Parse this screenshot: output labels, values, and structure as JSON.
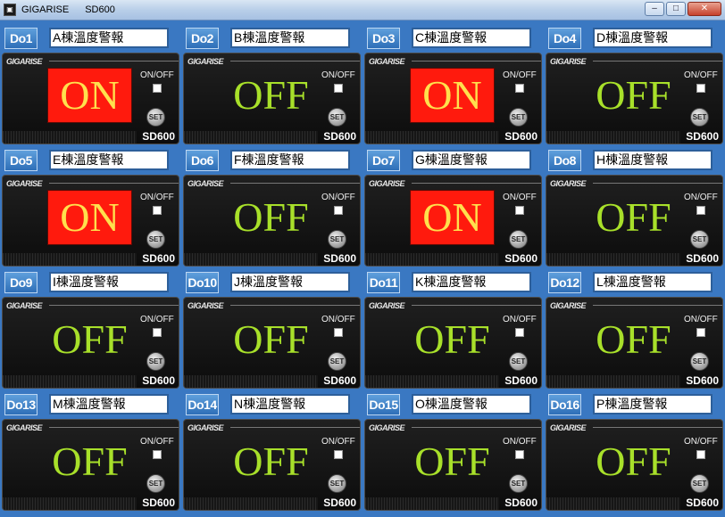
{
  "window": {
    "app_name": "GIGARISE",
    "model": "SD600",
    "icon": "app-icon",
    "buttons": {
      "minimize": "–",
      "maximize": "□",
      "close": "✕"
    }
  },
  "device_common": {
    "brand": "GIGARISE",
    "onoff_label": "ON/OFF",
    "set_label": "SET",
    "model": "SD600"
  },
  "colors": {
    "on_bg": "#ff1a0d",
    "on_text": "#ffe04d",
    "off_text": "#a8e02a",
    "label_blue": "#2e6fb8"
  },
  "channels": [
    {
      "label": "Do1",
      "name": "A棟溫度警報",
      "state": "ON"
    },
    {
      "label": "Do2",
      "name": "B棟溫度警報",
      "state": "OFF"
    },
    {
      "label": "Do3",
      "name": "C棟溫度警報",
      "state": "ON"
    },
    {
      "label": "Do4",
      "name": "D棟溫度警報",
      "state": "OFF"
    },
    {
      "label": "Do5",
      "name": "E棟溫度警報",
      "state": "ON"
    },
    {
      "label": "Do6",
      "name": "F棟溫度警報",
      "state": "OFF"
    },
    {
      "label": "Do7",
      "name": "G棟溫度警報",
      "state": "ON"
    },
    {
      "label": "Do8",
      "name": "H棟溫度警報",
      "state": "OFF"
    },
    {
      "label": "Do9",
      "name": "I棟溫度警報",
      "state": "OFF"
    },
    {
      "label": "Do10",
      "name": "J棟溫度警報",
      "state": "OFF"
    },
    {
      "label": "Do11",
      "name": "K棟溫度警報",
      "state": "OFF"
    },
    {
      "label": "Do12",
      "name": "L棟溫度警報",
      "state": "OFF"
    },
    {
      "label": "Do13",
      "name": "M棟溫度警報",
      "state": "OFF"
    },
    {
      "label": "Do14",
      "name": "N棟溫度警報",
      "state": "OFF"
    },
    {
      "label": "Do15",
      "name": "O棟溫度警報",
      "state": "OFF"
    },
    {
      "label": "Do16",
      "name": "P棟溫度警報",
      "state": "OFF"
    }
  ]
}
